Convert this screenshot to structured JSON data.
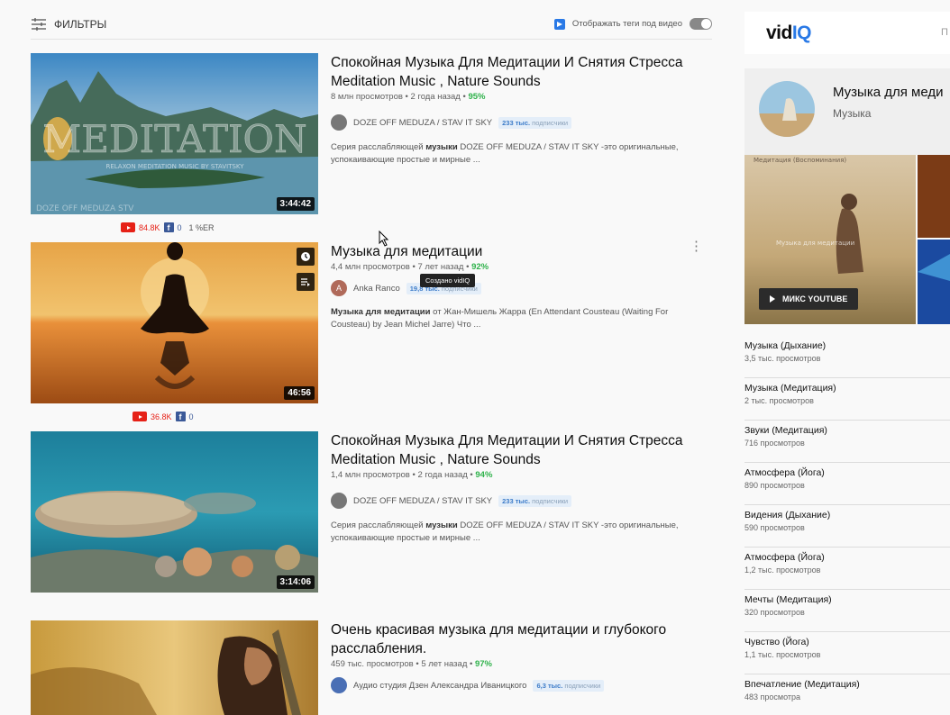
{
  "filters": {
    "label": "ФИЛЬТРЫ"
  },
  "tag_toggle": {
    "label": "Отображать теги под видео",
    "enabled": false
  },
  "videos": [
    {
      "title": "Спокойная Музыка Для Медитации И Снятия Стресса Meditation Music , Nature Sounds",
      "meta": "8 млн просмотров • 2 года назад • ",
      "pct": "95%",
      "channel": "DOZE OFF MEDUZA / STAV IT SKY",
      "subs_num": "233 тыс.",
      "subs_word": "подписчики",
      "desc_a": "Серия расслабляющей ",
      "desc_b": "музыки",
      "desc_c": " DOZE OFF MEDUZA / STAV IT SKY -это оригинальные, успокаивающие простые и мирные ...",
      "duration": "3:44:42",
      "thumb_caption": "MEDITATION",
      "thumb_small": "RELAXON MEDITATION MUSIC BY STAVITSKY",
      "thumb_watermark": "DOZE OFF MEDUZA STV",
      "stats_yt": "84.8K",
      "stats_fb": "0",
      "stats_extra": "1 %ER"
    },
    {
      "title": "Музыка для медитации",
      "meta": "4,4 млн просмотров • 7 лет назад • ",
      "pct": "92%",
      "channel": "Anka Ranco",
      "avatar_letter": "A",
      "subs_num": "19,8 тыс.",
      "subs_word": "подписчики",
      "desc_a": "",
      "desc_b": "Музыка для медитации",
      "desc_c": " от Жан-Мишель Жарра (En Attendant Cousteau (Waiting For Cousteau) by Jean Michel Jarre) Что ...",
      "duration": "46:56",
      "tooltip": "Создано vidIQ",
      "stats_yt": "36.8K",
      "stats_fb": "0"
    },
    {
      "title": "Спокойная Музыка Для Медитации И Снятия Стресса Meditation Music , Nature Sounds",
      "meta": "1,4 млн просмотров • 2 года назад • ",
      "pct": "94%",
      "channel": "DOZE OFF MEDUZA / STAV IT SKY",
      "subs_num": "233 тыс.",
      "subs_word": "подписчики",
      "desc_a": "Серия расслабляющей ",
      "desc_b": "музыки",
      "desc_c": " DOZE OFF MEDUZA / STAV IT SKY -это оригинальные, успокаивающие простые и мирные ...",
      "duration": "3:14:06"
    },
    {
      "title": "Очень красивая музыка для медитации и глубокого расслабления.",
      "meta": "459 тыс. просмотров • 5 лет назад • ",
      "pct": "97%",
      "channel": "Аудио студия Дзен Александра Иваницкого",
      "subs_num": "6,3 тыс.",
      "subs_word": "подписчики"
    }
  ],
  "sidebar": {
    "logo_a": "vid",
    "logo_b": "IQ",
    "tab_partial": "П",
    "mix_title": "Музыка для меди",
    "mix_subtitle": "Музыка",
    "collage_caption": "Медитация (Воспоминания)",
    "collage_caption2": "Музыка для медитации",
    "mix_button": "МИКС YOUTUBE",
    "related": [
      {
        "title": "Музыка (Дыхание)",
        "views": "3,5 тыс. просмотров"
      },
      {
        "title": "Музыка (Медитация)",
        "views": "2 тыс. просмотров"
      },
      {
        "title": "Звуки (Медитация)",
        "views": "716 просмотров"
      },
      {
        "title": "Атмосфера (Йога)",
        "views": "890 просмотров"
      },
      {
        "title": "Видения (Дыхание)",
        "views": "590 просмотров"
      },
      {
        "title": "Атмосфера (Йога)",
        "views": "1,2 тыс. просмотров"
      },
      {
        "title": "Мечты (Медитация)",
        "views": "320 просмотров"
      },
      {
        "title": "Чувство (Йога)",
        "views": "1,1 тыс. просмотров"
      },
      {
        "title": "Впечатление (Медитация)",
        "views": "483 просмотра"
      }
    ]
  },
  "colors": {
    "accent": "#2979e6",
    "youtube_red": "#e62117",
    "facebook": "#3b5998",
    "percent_green": "#2fb24b"
  }
}
